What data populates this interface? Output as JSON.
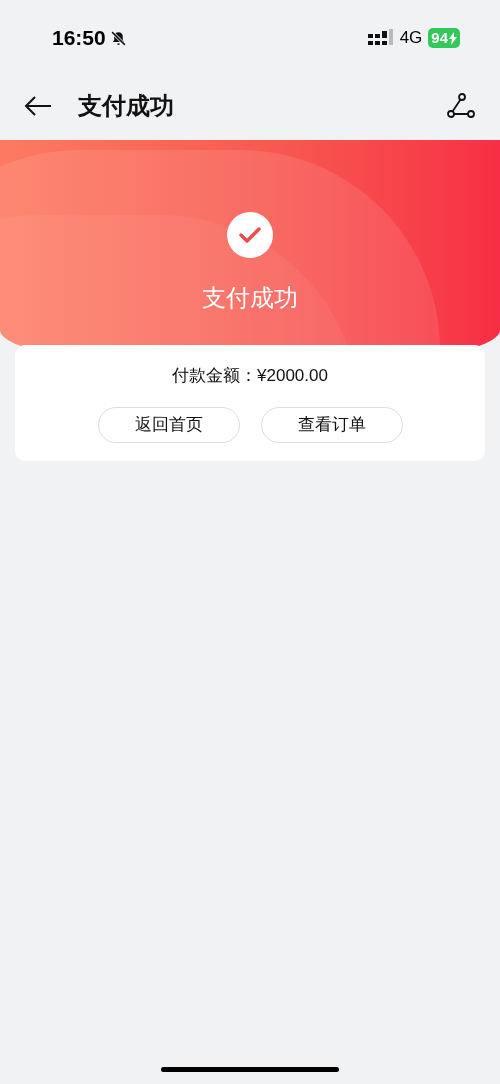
{
  "status_bar": {
    "time": "16:50",
    "network": "4G",
    "battery": "94"
  },
  "nav": {
    "title": "支付成功"
  },
  "banner": {
    "title": "支付成功"
  },
  "card": {
    "amount_label": "付款金额：",
    "amount": "¥2000.00",
    "buttons": [
      "返回首页",
      "查看订单"
    ]
  }
}
